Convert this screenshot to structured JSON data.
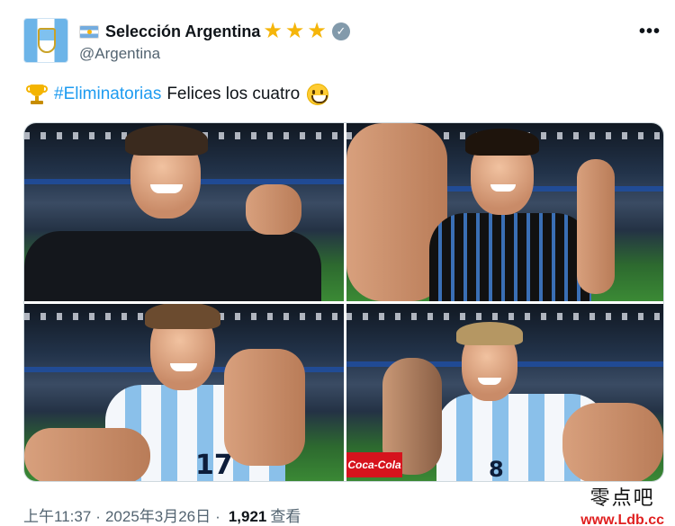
{
  "author": {
    "display_name": "Selección Argentina",
    "handle": "@Argentina",
    "stars": [
      "★",
      "★",
      "★"
    ]
  },
  "tweet": {
    "hashtag": "#Eliminatorias",
    "text": "Felices los cuatro"
  },
  "photos": {
    "p3_number": "17",
    "p4_number": "8",
    "p4_sponsor": "Coca-Cola"
  },
  "meta": {
    "time": "上午11:37",
    "separator1": "·",
    "date": "2025年3月26日",
    "separator2": "·",
    "views_count": "1,921",
    "views_label": "查看"
  },
  "watermark": {
    "site_name": "零点吧",
    "url": "www.Ldb.cc"
  },
  "colors": {
    "accent": "#1d9bf0",
    "stars": "#f5b50a",
    "muted": "#536471"
  },
  "icons": [
    "argentina-flag-icon",
    "verified-icon",
    "more-icon",
    "trophy-icon",
    "grinning-face-icon"
  ]
}
